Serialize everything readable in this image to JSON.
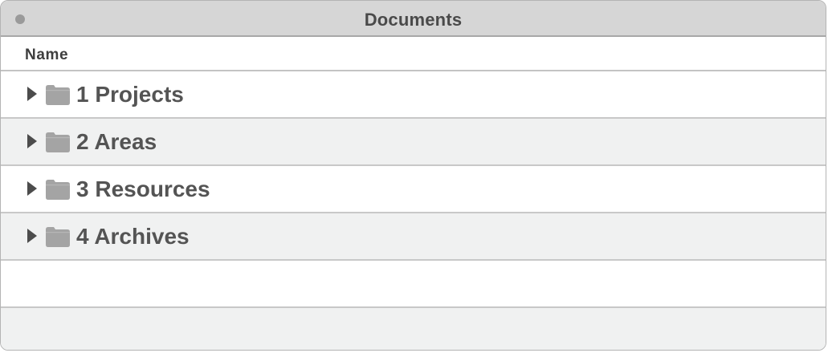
{
  "window": {
    "title": "Documents",
    "columns": {
      "name": "Name"
    }
  },
  "folders": [
    {
      "label": "1 Projects",
      "icon": "folder-icon"
    },
    {
      "label": "2 Areas",
      "icon": "folder-icon"
    },
    {
      "label": "3 Resources",
      "icon": "folder-icon"
    },
    {
      "label": "4 Archives",
      "icon": "folder-icon"
    }
  ],
  "colors": {
    "titlebar": "#d6d6d6",
    "row_alt": "#f0f1f1",
    "folder": "#a4a4a4",
    "text": "#545454"
  }
}
